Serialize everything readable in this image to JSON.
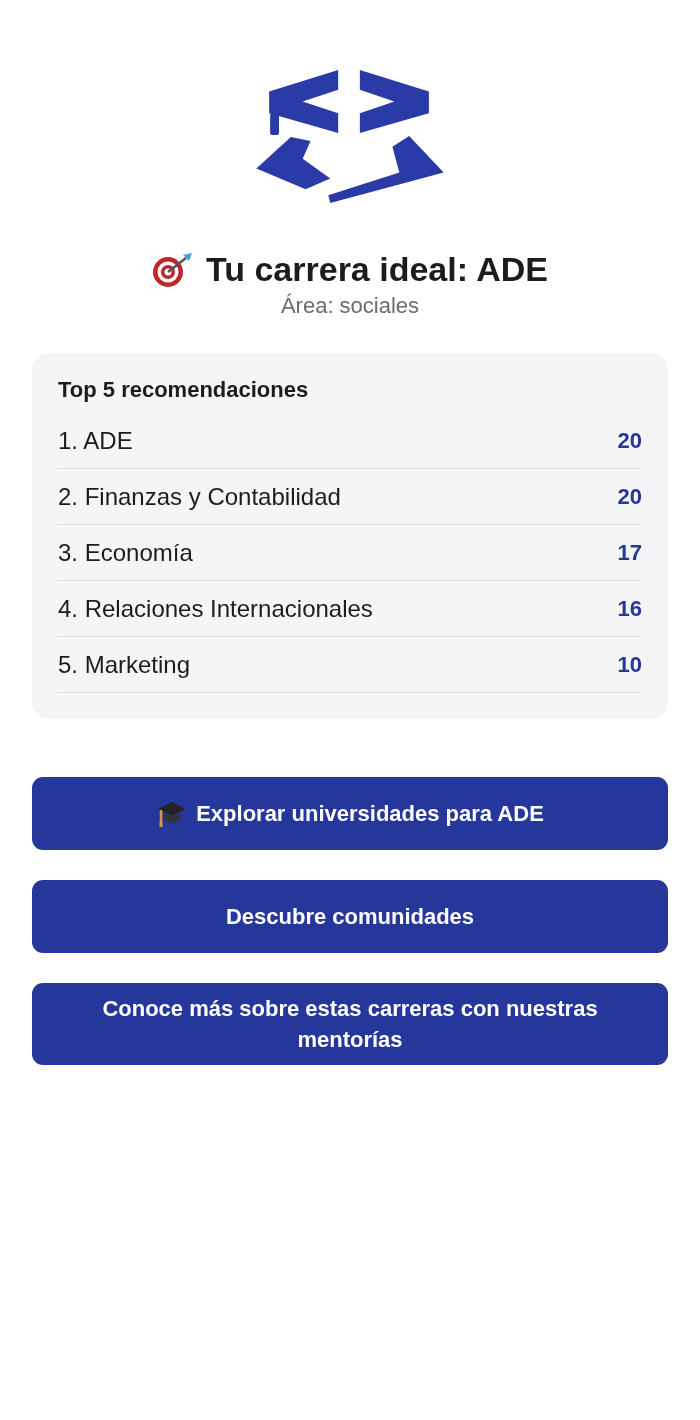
{
  "header": {
    "title": "Tu carrera ideal: ADE",
    "area": "Área: sociales"
  },
  "recommendations": {
    "title": "Top 5 recomendaciones",
    "items": [
      {
        "label": "1. ADE",
        "score": "20"
      },
      {
        "label": "2. Finanzas y Contabilidad",
        "score": "20"
      },
      {
        "label": "3. Economía",
        "score": "17"
      },
      {
        "label": "4. Relaciones Internacionales",
        "score": "16"
      },
      {
        "label": "5. Marketing",
        "score": "10"
      }
    ]
  },
  "buttons": [
    {
      "label": "Explorar universidades para ADE",
      "kind": "cap"
    },
    {
      "label": "Descubre comunidades",
      "kind": "plain"
    },
    {
      "label": "Conoce más sobre estas carreras con nuestras mentorías",
      "kind": "plain"
    }
  ]
}
